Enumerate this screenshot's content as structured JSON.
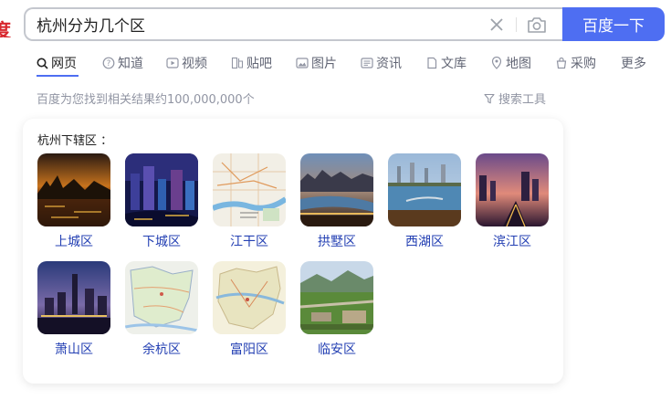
{
  "logo_fragment": "度",
  "search": {
    "value": "杭州分为几个区",
    "button_label": "百度一下"
  },
  "tabs": [
    {
      "label": "网页",
      "icon": "search-icon",
      "active": true
    },
    {
      "label": "知道",
      "icon": "question-icon"
    },
    {
      "label": "视频",
      "icon": "video-icon"
    },
    {
      "label": "贴吧",
      "icon": "tieba-icon"
    },
    {
      "label": "图片",
      "icon": "image-icon"
    },
    {
      "label": "资讯",
      "icon": "news-icon"
    },
    {
      "label": "文库",
      "icon": "document-icon"
    },
    {
      "label": "地图",
      "icon": "map-pin-icon"
    },
    {
      "label": "采购",
      "icon": "shopping-bag-icon"
    },
    {
      "label": "更多"
    }
  ],
  "result_count": "百度为您找到相关结果约100,000,000个",
  "search_tools": "搜索工具",
  "card": {
    "title": "杭州下辖区 ：",
    "districts": [
      {
        "name": "上城区",
        "thumb": "night-riverside-photo"
      },
      {
        "name": "下城区",
        "thumb": "night-city-photo"
      },
      {
        "name": "江干区",
        "thumb": "map-image"
      },
      {
        "name": "拱墅区",
        "thumb": "canal-night-photo"
      },
      {
        "name": "西湖区",
        "thumb": "lake-city-photo"
      },
      {
        "name": "滨江区",
        "thumb": "sunset-skyline-photo"
      },
      {
        "name": "萧山区",
        "thumb": "dusk-towers-photo"
      },
      {
        "name": "余杭区",
        "thumb": "map-image"
      },
      {
        "name": "富阳区",
        "thumb": "map-image"
      },
      {
        "name": "临安区",
        "thumb": "aerial-park-photo"
      }
    ]
  },
  "colors": {
    "brand_blue": "#4e6ef2",
    "link_blue": "#2440b3",
    "logo_red": "#d8262d"
  }
}
